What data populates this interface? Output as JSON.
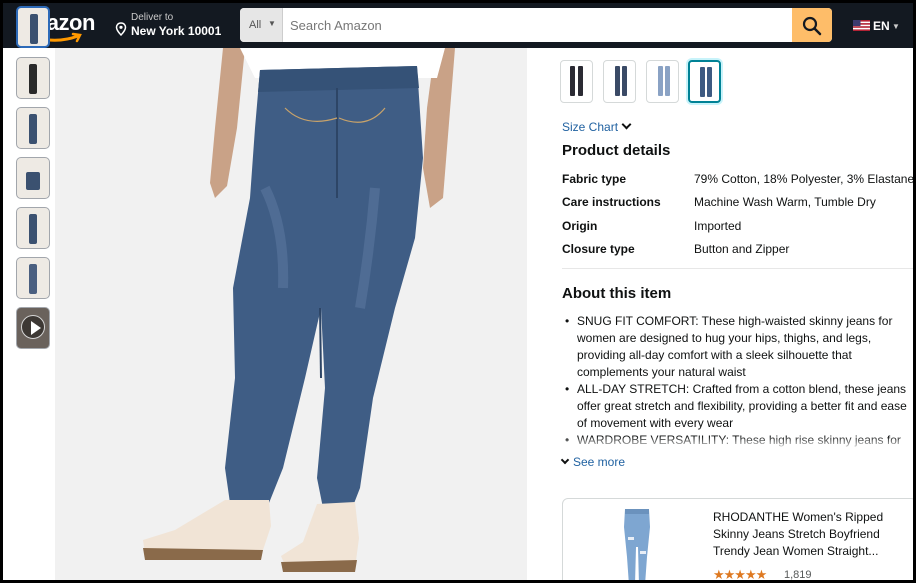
{
  "header": {
    "logo_text": "amazon",
    "deliver_line1": "Deliver to",
    "deliver_line2": "New York 10001",
    "search_category": "All",
    "search_placeholder": "Search Amazon",
    "language": "EN",
    "colors": {
      "nav_bg": "#131921",
      "search_button": "#febd69",
      "logo_smile": "#ff9900"
    }
  },
  "gallery": {
    "thumbnails": [
      "jeans-front",
      "jeans-model-back",
      "jeans-detail",
      "jeans-waist",
      "jeans-full-body",
      "jeans-side",
      "video"
    ],
    "selected_index": 0
  },
  "variants": {
    "swatch_colors": [
      "#2a2a33",
      "#3a4a66",
      "#8aa2c4",
      "#3d5a82"
    ],
    "selected_index": 3
  },
  "size_chart_label": "Size Chart",
  "product_details": {
    "title": "Product details",
    "rows": [
      {
        "key": "Fabric type",
        "value": "79% Cotton, 18% Polyester, 3% Elastane"
      },
      {
        "key": "Care instructions",
        "value": "Machine Wash Warm, Tumble Dry"
      },
      {
        "key": "Origin",
        "value": "Imported"
      },
      {
        "key": "Closure type",
        "value": "Button and Zipper"
      }
    ]
  },
  "about": {
    "title": "About this item",
    "bullets": [
      "SNUG FIT COMFORT: These high-waisted skinny jeans for women are designed to hug your hips, thighs, and legs, providing all-day comfort with a sleek silhouette that complements your natural waist",
      "ALL-DAY STRETCH: Crafted from a cotton blend, these jeans offer great stretch and flexibility, providing a better fit and ease of movement with every wear",
      "WARDROBE VERSATILITY: These high rise skinny jeans for"
    ],
    "see_more": "See more"
  },
  "related": {
    "title": "RHODANTHE Women's Ripped Skinny Jeans Stretch Boyfriend Trendy Jean Women Straight...",
    "stars": "★★★★★",
    "rating": 4.5,
    "rating_count": "1,819"
  }
}
